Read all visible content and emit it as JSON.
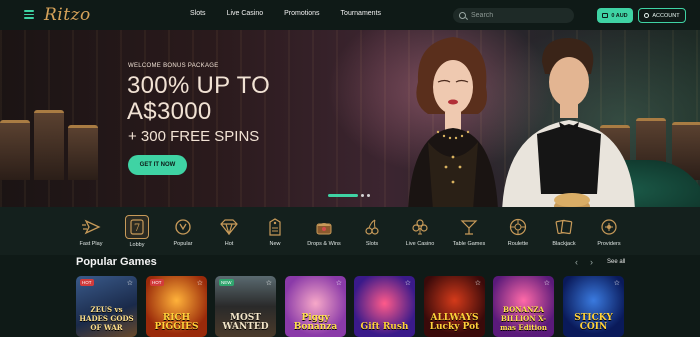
{
  "header": {
    "logo": "Ritzo",
    "nav": [
      "Slots",
      "Live Casino",
      "Promotions",
      "Tournaments"
    ],
    "search_placeholder": "Search",
    "balance_label": "0 AUD",
    "account_label": "ACCOUNT"
  },
  "hero": {
    "eyebrow": "WELCOME BONUS PACKAGE",
    "headline_line1": "300% UP TO",
    "headline_line2": "A$3000",
    "subline": "+ 300 FREE SPINS",
    "cta_label": "GET IT NOW",
    "slide_count": 3,
    "active_slide": 1
  },
  "categories": [
    {
      "label": "Fast Play",
      "icon": "fast-play-icon"
    },
    {
      "label": "Lobby",
      "icon": "lobby-icon",
      "active": true
    },
    {
      "label": "Popular",
      "icon": "popular-icon"
    },
    {
      "label": "Hot",
      "icon": "diamond-icon"
    },
    {
      "label": "New",
      "icon": "new-tag-icon"
    },
    {
      "label": "Drops & Wins",
      "icon": "drops-wins-icon"
    },
    {
      "label": "Slots",
      "icon": "cherries-icon"
    },
    {
      "label": "Live Casino",
      "icon": "clubs-icon"
    },
    {
      "label": "Table Games",
      "icon": "cocktail-icon"
    },
    {
      "label": "Roulette",
      "icon": "roulette-icon"
    },
    {
      "label": "Blackjack",
      "icon": "cards-icon"
    },
    {
      "label": "Providers",
      "icon": "providers-icon"
    }
  ],
  "popular": {
    "title": "Popular Games",
    "see_all": "See all",
    "games": [
      {
        "name": "ZEUS vs HADES GODS OF WAR",
        "badge": "HOT"
      },
      {
        "name": "RICH PIGGIES",
        "badge": "HOT"
      },
      {
        "name": "MOST WANTED",
        "badge": "NEW"
      },
      {
        "name": "Piggy Bonanza",
        "badge": ""
      },
      {
        "name": "Gift Rush",
        "badge": ""
      },
      {
        "name": "ALLWAYS Lucky Pot",
        "badge": ""
      },
      {
        "name": "BONANZA BILLION X-mas Edition",
        "badge": ""
      },
      {
        "name": "STICKY COIN",
        "badge": ""
      }
    ]
  },
  "colors": {
    "accent": "#3fd3a4",
    "gold": "#c79a59",
    "background": "#0f1a17"
  }
}
